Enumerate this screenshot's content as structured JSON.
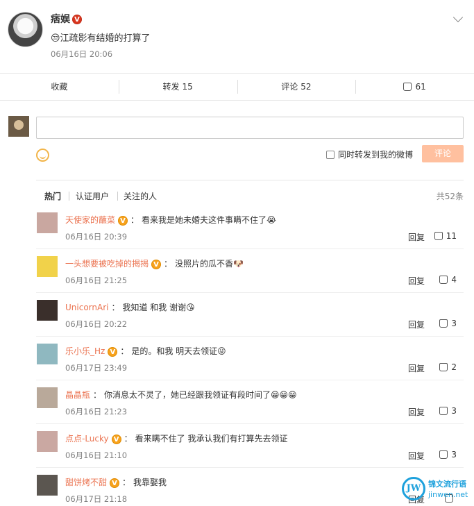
{
  "post": {
    "author": "痞娱",
    "verified_mark": "V",
    "text": "😒江疏影有结婚的打算了",
    "time": "06月16日 20:06"
  },
  "actions": {
    "collect": "收藏",
    "repost_label": "转发",
    "repost_count": "15",
    "comment_label": "评论",
    "comment_count": "52",
    "like_count": "61"
  },
  "compose": {
    "repost_checkbox_label": "同时转发到我的微博",
    "submit_label": "评论"
  },
  "tabs": {
    "items": [
      "热门",
      "认证用户",
      "关注的人"
    ],
    "total": "共52条"
  },
  "reply_label": "回复",
  "comments": [
    {
      "nick": "天使家的蘸菜",
      "verified": true,
      "text": "看来我是她未婚夫这件事瞒不住了",
      "emoji": "😭",
      "time": "06月16日 20:39",
      "likes": "11",
      "avatar_color": "#c9a7a0"
    },
    {
      "nick": "一头想要被吃掉的揭揭",
      "verified": true,
      "text": "没照片的瓜不香",
      "emoji": "🐶",
      "time": "06月16日 21:25",
      "likes": "4",
      "avatar_color": "#f1d24a"
    },
    {
      "nick": "UnicornAri",
      "verified": false,
      "text": "我知道 和我 谢谢",
      "emoji": "😘",
      "time": "06月16日 20:22",
      "likes": "3",
      "avatar_color": "#3a2f2b"
    },
    {
      "nick": "乐小乐_Hz",
      "verified": true,
      "text": "是的。和我 明天去领证",
      "emoji": "😜",
      "time": "06月17日 23:49",
      "likes": "2",
      "avatar_color": "#8fb8c0"
    },
    {
      "nick": "晶晶瓶",
      "verified": false,
      "text": "你消息太不灵了，她已经跟我领证有段时间了",
      "emoji": "😁😁😁",
      "time": "06月16日 21:23",
      "likes": "3",
      "avatar_color": "#b9a99a"
    },
    {
      "nick": "点点-Lucky",
      "verified": true,
      "text": "看来瞒不住了 我承认我们有打算先去领证",
      "emoji": "",
      "time": "06月16日 21:10",
      "likes": "3",
      "avatar_color": "#caa8a2"
    },
    {
      "nick": "甜饼烤不甜",
      "verified": true,
      "text": "我靠娶我",
      "emoji": "",
      "time": "06月17日 21:18",
      "likes": "",
      "avatar_color": "#5b5650"
    }
  ],
  "watermark": {
    "logo": "JW",
    "line1": "锦文流行语",
    "line2": "jinwen.net"
  },
  "colors": {
    "nick": "#eb7350",
    "submit_bg": "#ffc09f",
    "verified": "#f7a21c"
  }
}
